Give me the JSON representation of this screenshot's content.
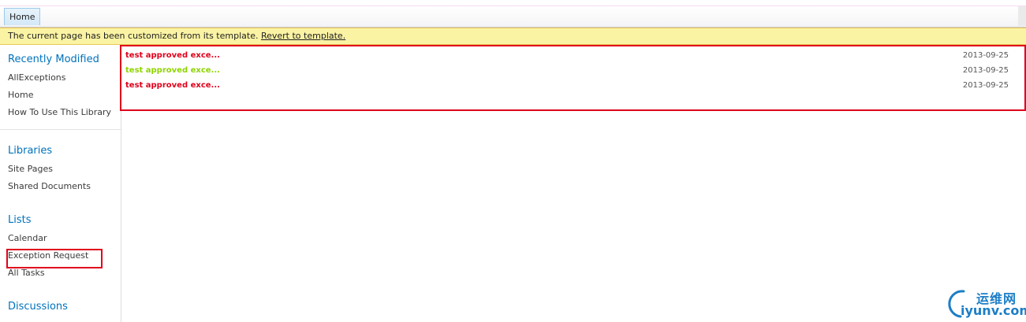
{
  "tabs": {
    "home_label": "Home"
  },
  "status": {
    "message": "The current page has been customized from its template.",
    "revert_link": "Revert to template."
  },
  "nav": {
    "recently_modified": {
      "heading": "Recently Modified",
      "items": [
        "AllExceptions",
        "Home",
        "How To Use This Library"
      ]
    },
    "libraries": {
      "heading": "Libraries",
      "items": [
        "Site Pages",
        "Shared Documents"
      ]
    },
    "lists": {
      "heading": "Lists",
      "items": [
        "Calendar",
        "Exception Request",
        "All Tasks"
      ]
    },
    "discussions": {
      "heading": "Discussions"
    }
  },
  "list_items": [
    {
      "title": "test approved exce...",
      "date": "2013-09-25",
      "color": "#e0001b"
    },
    {
      "title": "test approved exce...",
      "date": "2013-09-25",
      "color": "#8fd400"
    },
    {
      "title": "test approved exce...",
      "date": "2013-09-25",
      "color": "#e0001b"
    }
  ],
  "annotation_color": "#e0001b",
  "watermark": {
    "cn": "运维网",
    "en": "iyunv.com"
  }
}
